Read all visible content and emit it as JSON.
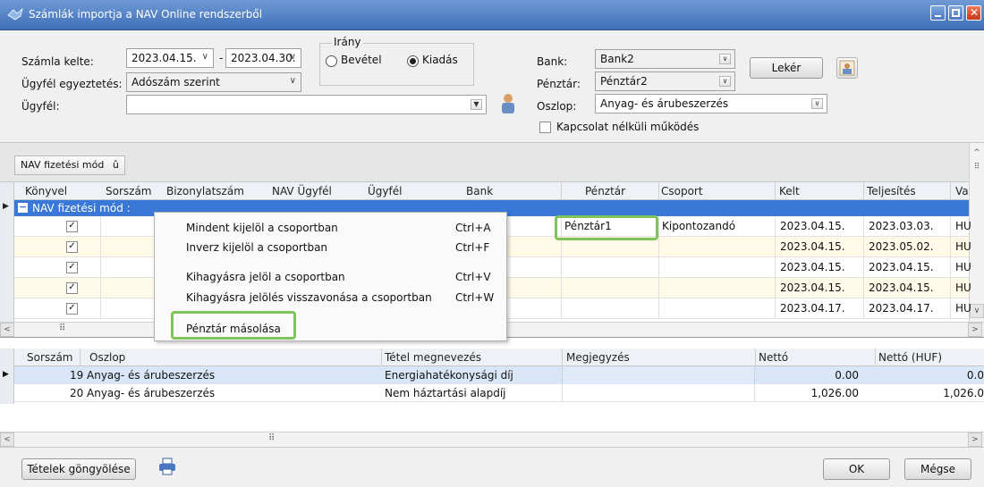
{
  "window": {
    "title": "Számlák importja a NAV Online rendszerből"
  },
  "form": {
    "date_label": "Számla kelte:",
    "date_from": "2023.04.15.",
    "date_sep": "-",
    "date_to": "2023.04.30.",
    "match_label": "Ügyfél egyeztetés:",
    "match_value": "Adószám szerint",
    "client_label": "Ügyfél:",
    "client_value": "",
    "direction_label": "Irány",
    "direction_income": "Bevétel",
    "direction_expense": "Kiadás",
    "direction_selected": "Kiadás",
    "bank_label": "Bank:",
    "bank_value": "Bank2",
    "cashbox_label": "Pénztár:",
    "cashbox_value": "Pénztár2",
    "column_label": "Oszlop:",
    "column_value": "Anyag- és árubeszerzés",
    "offline_label": "Kapcsolat nélküli működés",
    "fetch_label": "Lekér"
  },
  "grid": {
    "group_tag": "NAV fizetési mód",
    "group_tag_glyph": "û",
    "columns": [
      "Könyvel",
      "Sorszám",
      "Bizonylatszám",
      "NAV Ügyfél",
      "Ügyfél",
      "Bank",
      "Pénztár",
      "Csoport",
      "Kelt",
      "Teljesítés",
      "Va"
    ],
    "group_row": "NAV fizetési mód :",
    "rows": [
      {
        "cashbox": "Pénztár1",
        "group": "Kipontozandó",
        "date": "2023.04.15.",
        "fulfil": "2023.03.03.",
        "cur": "HU"
      },
      {
        "cashbox": "",
        "group": "",
        "date": "2023.04.15.",
        "fulfil": "2023.05.02.",
        "cur": "HU"
      },
      {
        "cashbox": "",
        "group": "",
        "date": "2023.04.15.",
        "fulfil": "2023.04.15.",
        "cur": "HU"
      },
      {
        "cashbox": "",
        "group": "",
        "date": "2023.04.15.",
        "fulfil": "2023.04.15.",
        "cur": "HU"
      },
      {
        "cashbox": "",
        "group": "",
        "date": "2023.04.17.",
        "fulfil": "2023.04.17.",
        "cur": "HU"
      }
    ]
  },
  "context_menu": {
    "items": [
      {
        "label": "Mindent kijelöl a csoportban",
        "shortcut": "Ctrl+A"
      },
      {
        "label": "Inverz kijelöl a csoportban",
        "shortcut": "Ctrl+F"
      },
      {
        "label": "Kihagyásra jelöl a csoportban",
        "shortcut": "Ctrl+V"
      },
      {
        "label": "Kihagyásra jelölés visszavonása a csoportban",
        "shortcut": "Ctrl+W"
      },
      {
        "label": "Pénztár másolása",
        "shortcut": ""
      }
    ]
  },
  "lower": {
    "columns": [
      "Sorszám",
      "Oszlop",
      "Tétel megnevezés",
      "Megjegyzés",
      "Nettó",
      "Nettó (HUF)"
    ],
    "rows": [
      {
        "no": "19",
        "column": "Anyag- és árubeszerzés",
        "item": "Energiahatékonysági díj",
        "note": "",
        "net": "0.00",
        "net_huf": "0.0"
      },
      {
        "no": "20",
        "column": "Anyag- és árubeszerzés",
        "item": "Nem háztartási alapdíj",
        "note": "",
        "net": "1,026.00",
        "net_huf": "1,026.0"
      }
    ]
  },
  "footer": {
    "rollup_label": "Tételek göngyölése",
    "ok_label": "OK",
    "cancel_label": "Mégse"
  },
  "colors": {
    "title_bar": "#3f6fb8",
    "group_row": "#3a78d8",
    "highlight": "#7fc45a",
    "alt_row": "#fffbe8"
  }
}
